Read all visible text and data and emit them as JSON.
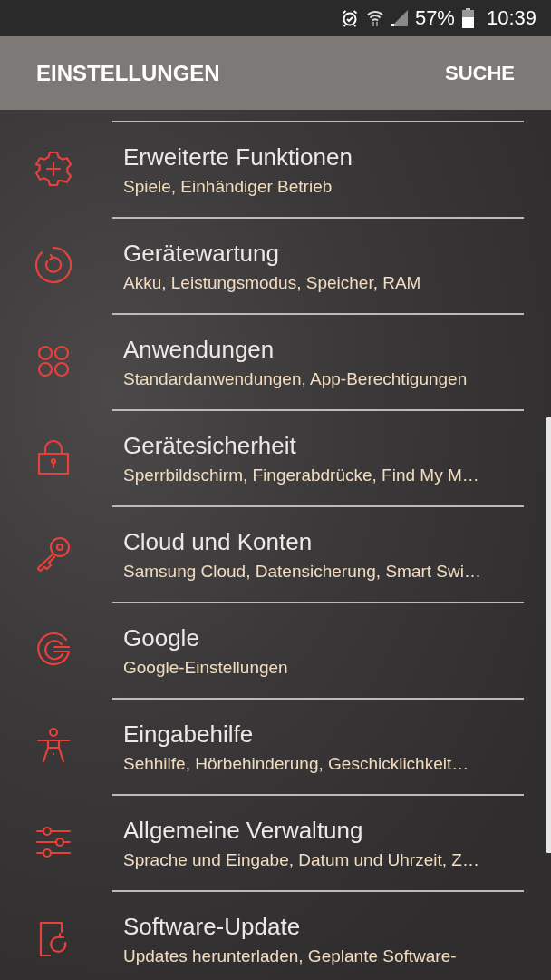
{
  "status_bar": {
    "battery": "57%",
    "time": "10:39"
  },
  "app_bar": {
    "title": "EINSTELLUNGEN",
    "action": "SUCHE"
  },
  "settings": [
    {
      "title": "Erweiterte Funktionen",
      "subtitle": "Spiele, Einhändiger Betrieb"
    },
    {
      "title": "Gerätewartung",
      "subtitle": "Akku, Leistungsmodus, Speicher, RAM"
    },
    {
      "title": "Anwendungen",
      "subtitle": "Standardanwendungen, App-Berechtigungen"
    },
    {
      "title": "Gerätesicherheit",
      "subtitle": "Sperrbildschirm, Fingerabdrücke, Find My M…"
    },
    {
      "title": "Cloud und Konten",
      "subtitle": "Samsung Cloud, Datensicherung, Smart Swi…"
    },
    {
      "title": "Google",
      "subtitle": "Google-Einstellungen"
    },
    {
      "title": "Eingabehilfe",
      "subtitle": "Sehhilfe, Hörbehinderung, Geschicklichkeit…"
    },
    {
      "title": "Allgemeine Verwaltung",
      "subtitle": "Sprache und Eingabe, Datum und Uhrzeit, Z…"
    },
    {
      "title": "Software-Update",
      "subtitle": "Updates herunterladen, Geplante Software-"
    }
  ]
}
